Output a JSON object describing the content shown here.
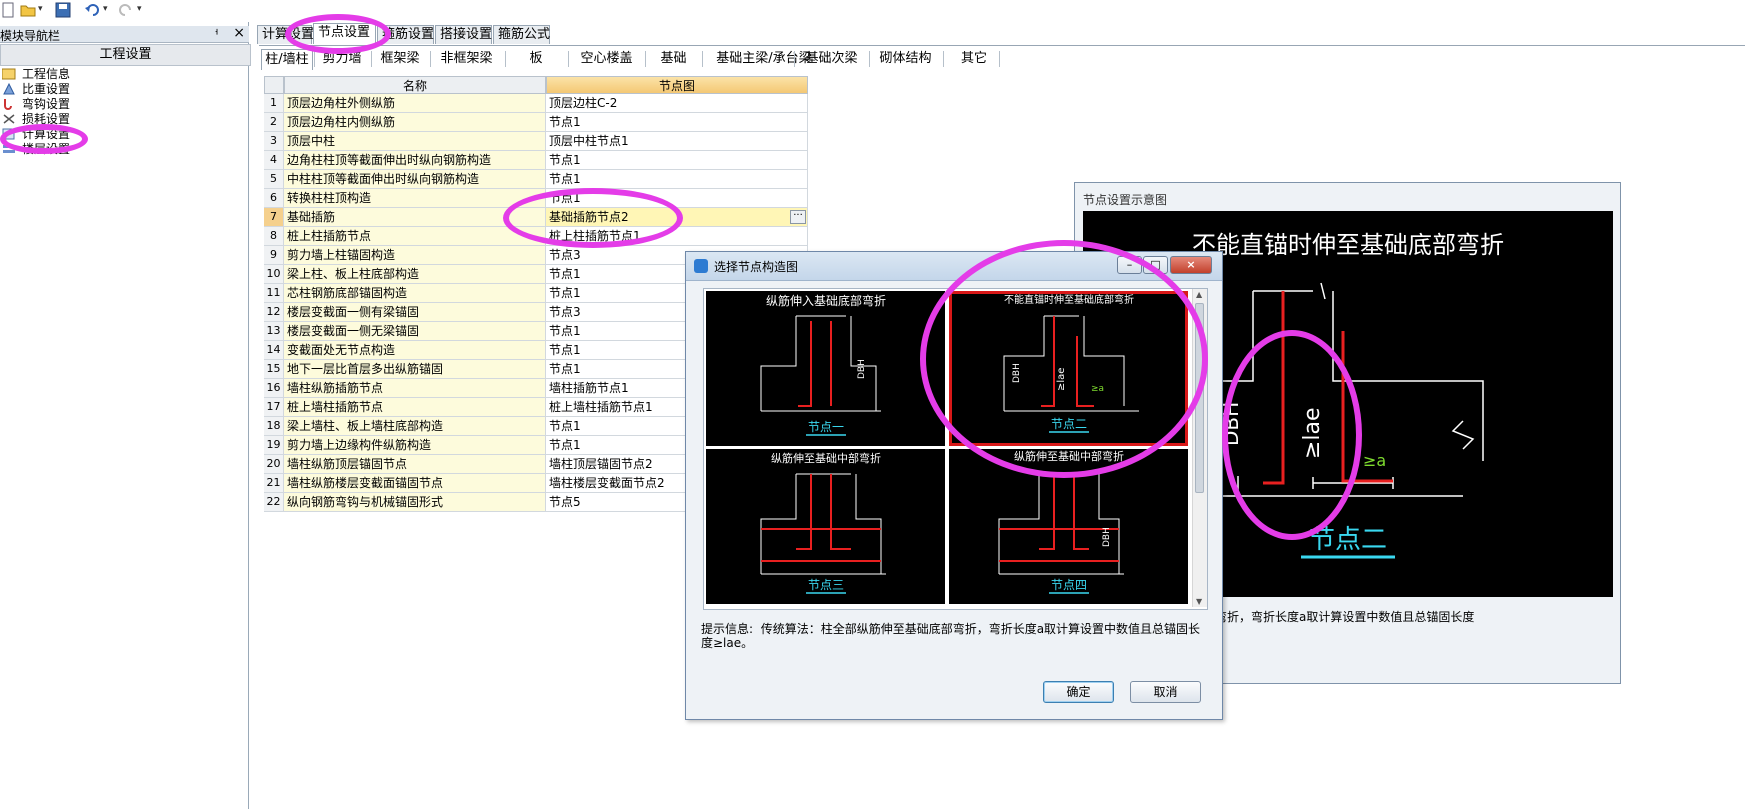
{
  "toolbar": {
    "icons": [
      "new-file-icon",
      "open-folder-icon",
      "save-icon",
      "undo-icon",
      "redo-icon"
    ]
  },
  "nav": {
    "title": "模块导航栏",
    "pin_glyph": "ᅥ",
    "close_glyph": "×",
    "header": "工程设置",
    "items": [
      {
        "label": "工程信息",
        "icon": "info-icon"
      },
      {
        "label": "比重设置",
        "icon": "weight-icon"
      },
      {
        "label": "弯钩设置",
        "icon": "hook-icon"
      },
      {
        "label": "损耗设置",
        "icon": "loss-icon"
      },
      {
        "label": "计算设置",
        "icon": "calc-icon"
      },
      {
        "label": "楼层设置",
        "icon": "floor-icon"
      }
    ]
  },
  "tabs": [
    "计算设置",
    "节点设置",
    "箍筋设置",
    "搭接设置",
    "箍筋公式"
  ],
  "active_tab": "节点设置",
  "subtabs": [
    "柱/墙柱",
    "剪力墙",
    "框架梁",
    "非框架梁",
    "板",
    "空心楼盖",
    "基础",
    "基础主梁/承台梁",
    "基础次梁",
    "砌体结构",
    "其它"
  ],
  "grid": {
    "headers": {
      "name": "名称",
      "value": "节点图"
    },
    "rows": [
      {
        "n": "1",
        "name": "顶层边角柱外侧纵筋",
        "value": "顶层边柱C-2"
      },
      {
        "n": "2",
        "name": "顶层边角柱内侧纵筋",
        "value": "节点1"
      },
      {
        "n": "3",
        "name": "顶层中柱",
        "value": "顶层中柱节点1"
      },
      {
        "n": "4",
        "name": "边角柱柱顶等截面伸出时纵向钢筋构造",
        "value": "节点1"
      },
      {
        "n": "5",
        "name": "中柱柱顶等截面伸出时纵向钢筋构造",
        "value": "节点1"
      },
      {
        "n": "6",
        "name": "转换柱柱顶构造",
        "value": "节点1"
      },
      {
        "n": "7",
        "name": "基础插筋",
        "value": "基础插筋节点2"
      },
      {
        "n": "8",
        "name": "桩上柱插筋节点",
        "value": "桩上柱插筋节点1"
      },
      {
        "n": "9",
        "name": "剪力墙上柱锚固构造",
        "value": "节点3"
      },
      {
        "n": "10",
        "name": "梁上柱、板上柱底部构造",
        "value": "节点1"
      },
      {
        "n": "11",
        "name": "芯柱钢筋底部锚固构造",
        "value": "节点1"
      },
      {
        "n": "12",
        "name": "楼层变截面一侧有梁锚固",
        "value": "节点3"
      },
      {
        "n": "13",
        "name": "楼层变截面一侧无梁锚固",
        "value": "节点1"
      },
      {
        "n": "14",
        "name": "变截面处无节点构造",
        "value": "节点1"
      },
      {
        "n": "15",
        "name": "地下一层比首层多出纵筋锚固",
        "value": "节点1"
      },
      {
        "n": "16",
        "name": "墙柱纵筋插筋节点",
        "value": "墙柱插筋节点1"
      },
      {
        "n": "17",
        "name": "桩上墙柱插筋节点",
        "value": "桩上墙柱插筋节点1"
      },
      {
        "n": "18",
        "name": "梁上墙柱、板上墙柱底部构造",
        "value": "节点1"
      },
      {
        "n": "19",
        "name": "剪力墙上边缘构件纵筋构造",
        "value": "节点1"
      },
      {
        "n": "20",
        "name": "墙柱纵筋顶层锚固节点",
        "value": "墙柱顶层锚固节点2"
      },
      {
        "n": "21",
        "name": "墙柱纵筋楼层变截面锚固节点",
        "value": "墙柱楼层变截面节点2"
      },
      {
        "n": "22",
        "name": "纵向钢筋弯钩与机械锚固形式",
        "value": "节点5"
      }
    ],
    "selected_row": "7",
    "ellipsis_label": "···"
  },
  "preview": {
    "title": "节点设置示意图",
    "heading": "不能直锚时伸至基础底部弯折",
    "dbh": "DBH",
    "lae": "≥lae",
    "a_label": "≥a",
    "node_label": "节点二",
    "hint": "柱全部纵筋伸至基础底部弯折，弯折长度a取计算设置中数值且总锚固长度"
  },
  "dialog": {
    "title": "选择节点构造图",
    "btn_min": "–",
    "btn_max": "□",
    "btn_close": "×",
    "scroll_up": "▲",
    "scroll_down": "▼",
    "thumbs": [
      {
        "caption": "纵筋伸入基础底部弯折",
        "label": "节点一",
        "selected": false
      },
      {
        "caption": "不能直锚时伸至基础底部弯折",
        "label": "节点二",
        "selected": true
      },
      {
        "caption": "纵筋伸至基础中部弯折",
        "label": "节点三",
        "selected": false
      },
      {
        "caption": "纵筋伸至基础中部弯折",
        "label": "节点四",
        "selected": false
      }
    ],
    "hint_label": "提示信息:",
    "hint_text": "传统算法：柱全部纵筋伸至基础底部弯折，弯折长度a取计算设置中数值且总锚固长度≥lae。",
    "ok": "确定",
    "cancel": "取消"
  },
  "colors": {
    "rebar": "#e82020",
    "caption_cyan": "#3ad8f0",
    "annotation": "#e43ce8",
    "selected_row": "#fff6b6"
  }
}
